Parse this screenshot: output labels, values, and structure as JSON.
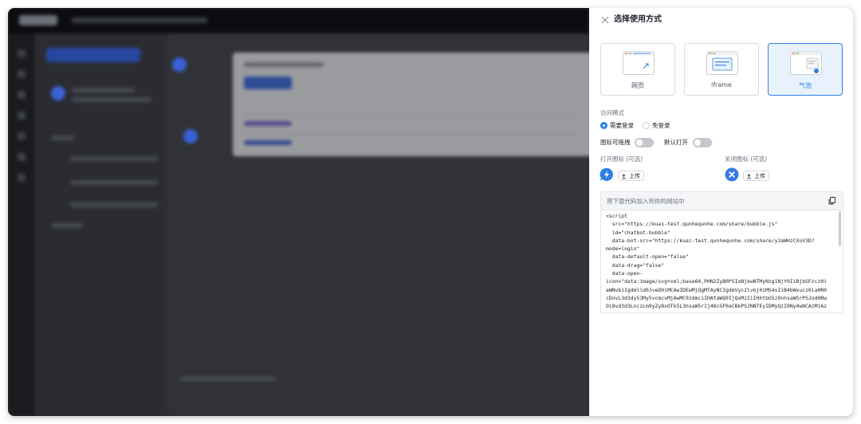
{
  "panel": {
    "title": "选择使用方式",
    "options": [
      {
        "label": "网页",
        "selected": false
      },
      {
        "label": "iframe",
        "selected": false
      },
      {
        "label": "气泡",
        "selected": true
      }
    ],
    "access_mode_label": "访问模式",
    "access_modes": [
      {
        "label": "需要登录",
        "selected": true
      },
      {
        "label": "免登录",
        "selected": false
      }
    ],
    "draggable_label": "图标可拖拽",
    "draggable_on": false,
    "default_open_label": "默认打开",
    "default_open_on": false,
    "open_icon_label": "打开图标 (可选)",
    "close_icon_label": "关闭图标 (可选)",
    "upload_label": "上传",
    "code_hint": "将下面代码加入到你的网站中",
    "code": "<script\n  src=\"https://kuai-test.qunhequnhe.com/share/bubble.js\"\n  id=\"chatbot-bubble\"\n  data-bot-src=\"https://kuai-test.qunhequnhe.com/share/y3aWHzCXoV3D?\nmode=login\"\n  data-default-open=\"false\"\n  data-drag=\"false\"\n  data-open-\nicon=\"data:image/svg+xml;base64,PHN2ZyB0PSIxNjkwNTMyNzg1NjY0IiBjbGFzcz0i\naWNvbiIgdmlld0JveD0iMCAwIDEwMjQgMTAyNCIgdmVyc2lvbj0iMS4xIiB4bWxucz0iaHR0\ncDovL3d3dy53My5vcmcvMjAwMC9zdmciIHAtaWQ9IjQxMzIiIHhtbG5zOnhsaW5rPSJodHRw\nOi8vd3d3LnczLm9yZy8xOTk5L3hsaW5rIj48cGF0aCBkPSJNNTEyIDMyQzI0Ny4wNCAzMiAz",
    "colors": {
      "accent": "#2f7fe6",
      "selected_bg": "#e8f2fd",
      "open_icon": "#2f7fe6",
      "close_icon": "#3a78e7"
    }
  },
  "icons": {
    "close": "close-icon",
    "open": "lightning-bubble-icon",
    "close_bubble": "x-circle-icon",
    "upload": "upload-icon",
    "copy": "copy-icon"
  }
}
